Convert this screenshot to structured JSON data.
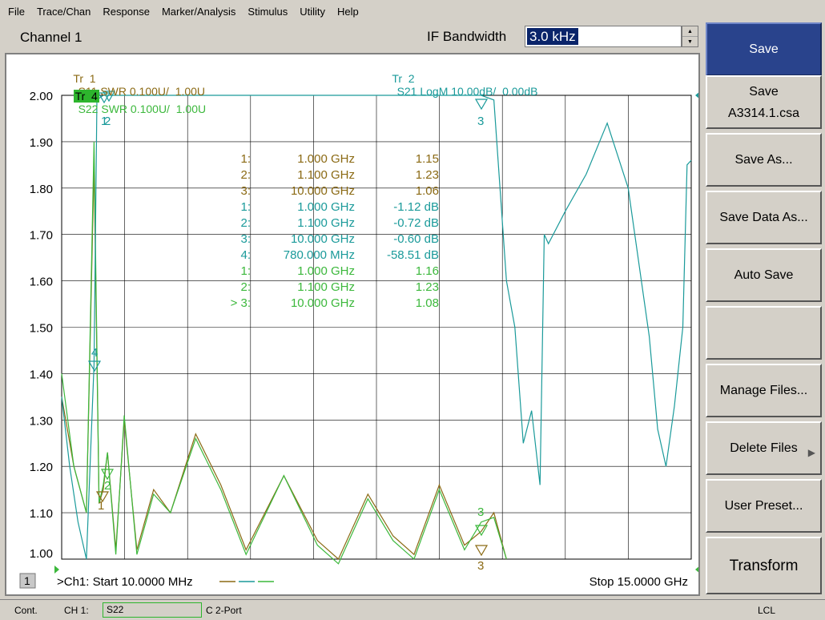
{
  "menu": [
    "File",
    "Trace/Chan",
    "Response",
    "Marker/Analysis",
    "Stimulus",
    "Utility",
    "Help"
  ],
  "channel": {
    "title": "Channel 1",
    "ifbw_label": "IF Bandwidth",
    "ifbw_value": "3.0 kHz"
  },
  "traces": [
    {
      "id": "tr1",
      "label": "Tr  1",
      "desc": "S11 SWR 0.100U/  1.00U",
      "color": "#8b6a14"
    },
    {
      "id": "tr2",
      "label": "Tr  2",
      "desc": "S21 LogM 10.00dB/  0.00dB",
      "color": "#1a9a9a"
    },
    {
      "id": "tr4",
      "label": "Tr  4",
      "desc": "S22 SWR 0.100U/  1.00U",
      "color": "#3cb83c"
    }
  ],
  "y_ticks": [
    "2.00",
    "1.90",
    "1.80",
    "1.70",
    "1.60",
    "1.50",
    "1.40",
    "1.30",
    "1.20",
    "1.10",
    "1.00"
  ],
  "markers": [
    {
      "num": "1:",
      "freq": "1.000 GHz",
      "val": "1.15",
      "trace": "tr1"
    },
    {
      "num": "2:",
      "freq": "1.100 GHz",
      "val": "1.23",
      "trace": "tr1"
    },
    {
      "num": "3:",
      "freq": "10.000 GHz",
      "val": "1.06",
      "trace": "tr1"
    },
    {
      "num": "1:",
      "freq": "1.000 GHz",
      "val": "-1.12 dB",
      "trace": "tr2"
    },
    {
      "num": "2:",
      "freq": "1.100 GHz",
      "val": "-0.72 dB",
      "trace": "tr2"
    },
    {
      "num": "3:",
      "freq": "10.000 GHz",
      "val": "-0.60 dB",
      "trace": "tr2"
    },
    {
      "num": "4:",
      "freq": "780.000 MHz",
      "val": "-58.51 dB",
      "trace": "tr2"
    },
    {
      "num": "1:",
      "freq": "1.000 GHz",
      "val": "1.16",
      "trace": "tr4"
    },
    {
      "num": "2:",
      "freq": "1.100 GHz",
      "val": "1.23",
      "trace": "tr4"
    },
    {
      "num": "> 3:",
      "freq": "10.000 GHz",
      "val": "1.08",
      "trace": "tr4"
    }
  ],
  "stimulus": {
    "channel_box": "1",
    "start": ">Ch1: Start  10.0000 MHz",
    "stop": "Stop  15.0000 GHz"
  },
  "softkeys": [
    {
      "lines": [
        "Save"
      ],
      "active": true
    },
    {
      "lines": [
        "Save",
        "A3314.1.csa"
      ]
    },
    {
      "lines": [
        "Save As..."
      ]
    },
    {
      "lines": [
        "Save Data As..."
      ]
    },
    {
      "lines": [
        "Auto Save"
      ]
    },
    {
      "lines": [
        ""
      ]
    },
    {
      "lines": [
        "Manage Files..."
      ]
    },
    {
      "lines": [
        "Delete Files"
      ],
      "arrow": true
    },
    {
      "lines": [
        "User Preset..."
      ]
    },
    {
      "lines": [
        "Transform"
      ],
      "big": true
    }
  ],
  "status": {
    "mode": "Cont.",
    "channel": "CH 1:",
    "trace": "S22",
    "cal": "C  2-Port",
    "lcl": "LCL"
  },
  "chart_data": {
    "type": "line",
    "x_start_ghz": 0.01,
    "x_stop_ghz": 15.0,
    "ylim": [
      1.0,
      2.0
    ],
    "series": [
      {
        "name": "S11 SWR",
        "color": "#8b6a14",
        "points": [
          [
            0.01,
            1.35
          ],
          [
            0.3,
            1.2
          ],
          [
            0.6,
            1.1
          ],
          [
            0.78,
            1.85
          ],
          [
            0.9,
            1.12
          ],
          [
            1.0,
            1.15
          ],
          [
            1.1,
            1.23
          ],
          [
            1.3,
            1.02
          ],
          [
            1.5,
            1.3
          ],
          [
            1.8,
            1.02
          ],
          [
            2.2,
            1.15
          ],
          [
            2.6,
            1.1
          ],
          [
            3.2,
            1.27
          ],
          [
            3.8,
            1.16
          ],
          [
            4.4,
            1.02
          ],
          [
            5.3,
            1.18
          ],
          [
            6.1,
            1.04
          ],
          [
            6.6,
            1.0
          ],
          [
            7.3,
            1.14
          ],
          [
            7.9,
            1.05
          ],
          [
            8.4,
            1.01
          ],
          [
            9.0,
            1.16
          ],
          [
            9.6,
            1.03
          ],
          [
            10.0,
            1.06
          ],
          [
            10.3,
            1.1
          ],
          [
            10.6,
            1.0
          ]
        ]
      },
      {
        "name": "S22 SWR",
        "color": "#3cb83c",
        "points": [
          [
            0.01,
            1.4
          ],
          [
            0.3,
            1.2
          ],
          [
            0.6,
            1.1
          ],
          [
            0.78,
            1.9
          ],
          [
            0.9,
            1.12
          ],
          [
            1.0,
            1.16
          ],
          [
            1.1,
            1.23
          ],
          [
            1.3,
            1.01
          ],
          [
            1.5,
            1.31
          ],
          [
            1.8,
            1.01
          ],
          [
            2.2,
            1.14
          ],
          [
            2.6,
            1.1
          ],
          [
            3.2,
            1.26
          ],
          [
            3.8,
            1.15
          ],
          [
            4.4,
            1.01
          ],
          [
            5.3,
            1.18
          ],
          [
            6.1,
            1.03
          ],
          [
            6.6,
            0.99
          ],
          [
            7.3,
            1.13
          ],
          [
            7.9,
            1.04
          ],
          [
            8.4,
            1.0
          ],
          [
            9.0,
            1.15
          ],
          [
            9.6,
            1.02
          ],
          [
            10.0,
            1.08
          ],
          [
            10.3,
            1.09
          ],
          [
            10.6,
            1.0
          ]
        ]
      },
      {
        "name": "S21 LogM",
        "color": "#1a9a9a",
        "points": [
          [
            0.01,
            1.35
          ],
          [
            0.2,
            1.2
          ],
          [
            0.4,
            1.08
          ],
          [
            0.6,
            1.0
          ],
          [
            0.78,
            1.42
          ],
          [
            0.85,
            1.99
          ],
          [
            1.0,
            2.0
          ],
          [
            1.1,
            2.0
          ],
          [
            3.0,
            2.0
          ],
          [
            10.0,
            2.0
          ],
          [
            10.3,
            1.99
          ],
          [
            10.6,
            1.6
          ],
          [
            10.8,
            1.5
          ],
          [
            11.0,
            1.25
          ],
          [
            11.2,
            1.32
          ],
          [
            11.4,
            1.16
          ],
          [
            11.5,
            1.7
          ],
          [
            11.6,
            1.68
          ],
          [
            12.0,
            1.75
          ],
          [
            12.5,
            1.83
          ],
          [
            13.0,
            1.94
          ],
          [
            13.5,
            1.8
          ],
          [
            14.0,
            1.48
          ],
          [
            14.2,
            1.28
          ],
          [
            14.4,
            1.2
          ],
          [
            14.6,
            1.33
          ],
          [
            14.8,
            1.5
          ],
          [
            14.9,
            1.85
          ],
          [
            15.0,
            1.86
          ]
        ]
      }
    ]
  }
}
